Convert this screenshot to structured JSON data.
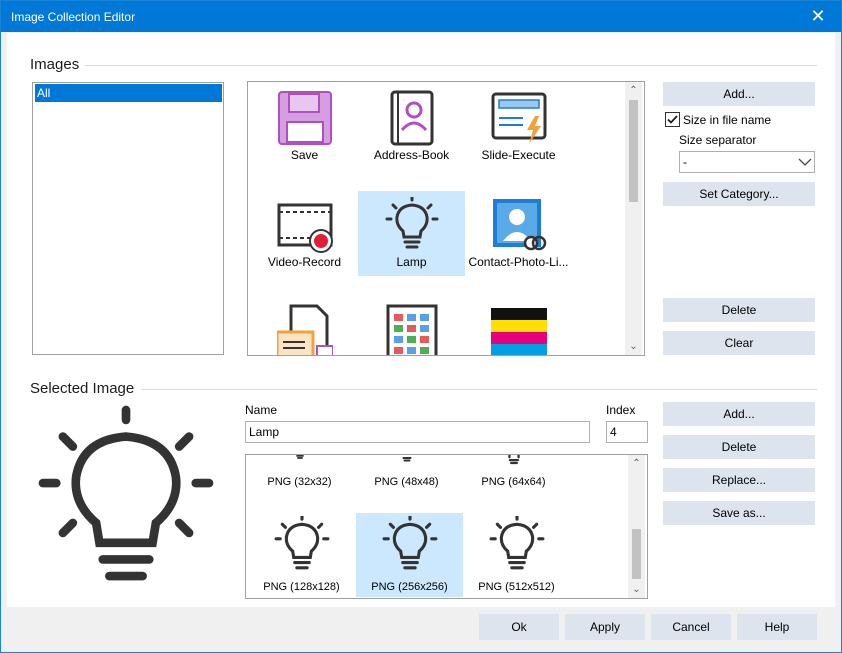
{
  "window": {
    "title": "Image Collection Editor",
    "close_glyph": "✕"
  },
  "images_section": {
    "title": "Images",
    "categories": [
      "All"
    ],
    "tiles": [
      {
        "label": "Save",
        "icon": "save-icon"
      },
      {
        "label": "Address-Book",
        "icon": "address-book-icon"
      },
      {
        "label": "Slide-Execute",
        "icon": "slide-execute-icon"
      },
      {
        "label": "Video-Record",
        "icon": "video-record-icon"
      },
      {
        "label": "Lamp",
        "icon": "lamp-icon"
      },
      {
        "label": "Contact-Photo-Li...",
        "icon": "contact-photo-link-icon"
      },
      {
        "label": "",
        "icon": "document-folder-icon"
      },
      {
        "label": "",
        "icon": "color-grid-icon"
      },
      {
        "label": "",
        "icon": "color-stripes-icon"
      }
    ],
    "buttons": {
      "add": "Add...",
      "set_category": "Set Category...",
      "delete": "Delete",
      "clear": "Clear"
    },
    "size_in_file_name": {
      "label": "Size in file name",
      "checked": true
    },
    "size_separator": {
      "label": "Size separator",
      "value": "-"
    }
  },
  "selected_section": {
    "title": "Selected Image",
    "name_label": "Name",
    "name_value": "Lamp",
    "index_label": "Index",
    "index_value": "4",
    "sizes": [
      {
        "label": "PNG (32x32)"
      },
      {
        "label": "PNG (48x48)"
      },
      {
        "label": "PNG (64x64)"
      },
      {
        "label": "PNG (128x128)"
      },
      {
        "label": "PNG (256x256)"
      },
      {
        "label": "PNG (512x512)"
      }
    ],
    "buttons": {
      "add": "Add...",
      "delete": "Delete",
      "replace": "Replace...",
      "save_as": "Save as..."
    }
  },
  "footer": {
    "ok": "Ok",
    "apply": "Apply",
    "cancel": "Cancel",
    "help": "Help"
  },
  "colors": {
    "accent": "#0078d7",
    "button": "#dde4ee",
    "selection": "#cce8ff",
    "purple": "#b04fc3",
    "orange": "#f3a13c",
    "blue": "#1e7ed6",
    "icon_dark": "#333333"
  }
}
